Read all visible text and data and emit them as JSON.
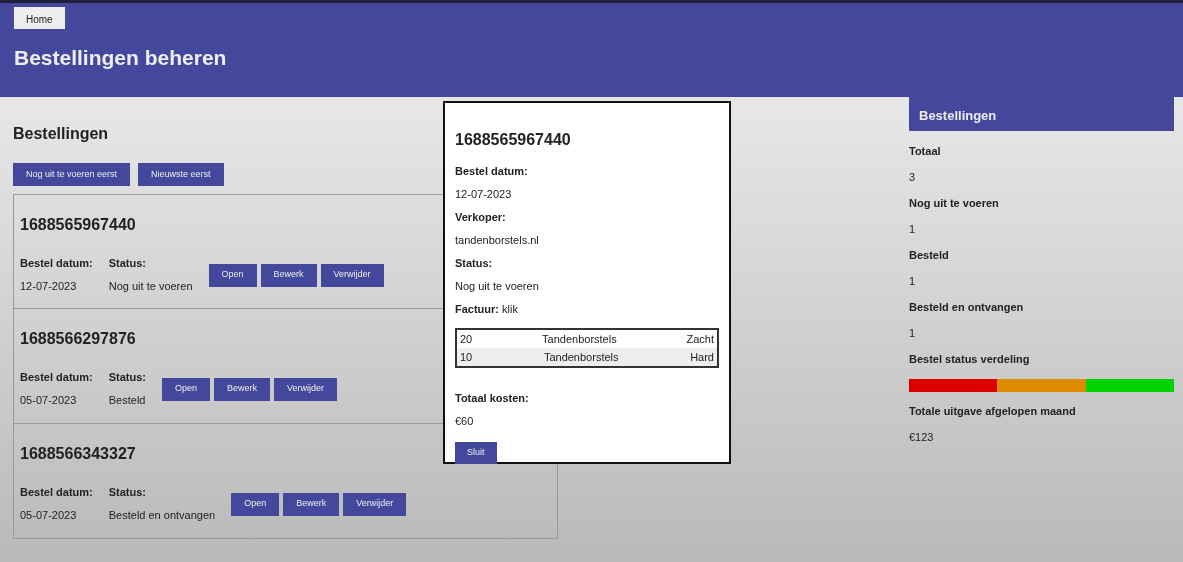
{
  "nav": {
    "home": "Home"
  },
  "page_title": "Bestellingen beheren",
  "orders_section": {
    "title": "Bestellingen",
    "sort_buttons": [
      "Nog uit te voeren eerst",
      "Nieuwste eerst"
    ],
    "orders": [
      {
        "id": "1688565967440",
        "date_label": "Bestel datum:",
        "date": "12-07-2023",
        "status_label": "Status:",
        "status": "Nog uit te voeren",
        "buttons": [
          "Open",
          "Bewerk",
          "Verwijder"
        ]
      },
      {
        "id": "1688566297876",
        "date_label": "Bestel datum:",
        "date": "05-07-2023",
        "status_label": "Status:",
        "status": "Besteld",
        "buttons": [
          "Open",
          "Bewerk",
          "Verwijder"
        ]
      },
      {
        "id": "1688566343327",
        "date_label": "Bestel datum:",
        "date": "05-07-2023",
        "status_label": "Status:",
        "status": "Besteld en ontvangen",
        "buttons": [
          "Open",
          "Bewerk",
          "Verwijder"
        ]
      }
    ]
  },
  "detail_dialog": {
    "id": "1688565967440",
    "fields": [
      {
        "label": "Bestel datum:",
        "value": "12-07-2023"
      },
      {
        "label": "Verkoper:",
        "value": "tandenborstels.nl"
      },
      {
        "label": "Status:",
        "value": "Nog uit te voeren"
      }
    ],
    "invoice_label": "Factuur:",
    "invoice_link": "klik",
    "items": [
      {
        "quantity": "20",
        "product": "Tandenborstels",
        "type": "Zacht"
      },
      {
        "quantity": "10",
        "product": "Tandenborstels",
        "type": "Hard"
      }
    ],
    "total_label": "Totaal kosten:",
    "total": "€60",
    "close_button": "Sluit"
  },
  "summary": {
    "title": "Bestellingen",
    "stats": [
      {
        "label": "Totaal",
        "value": "3"
      },
      {
        "label": "Nog uit te voeren",
        "value": "1"
      },
      {
        "label": "Besteld",
        "value": "1"
      },
      {
        "label": "Besteld en ontvangen",
        "value": "1"
      }
    ],
    "distribution": {
      "label": "Bestel status verdeling",
      "segments": [
        {
          "color": "#dd0000"
        },
        {
          "color": "#dd8c00"
        },
        {
          "color": "#00d400"
        }
      ]
    },
    "monthly_label": "Totale uitgave afgelopen maand",
    "monthly_value": "€123"
  }
}
